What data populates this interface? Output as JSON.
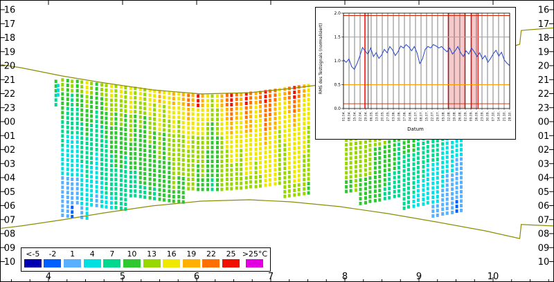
{
  "chart_data": [
    {
      "type": "heatmap",
      "title": "",
      "description": "Night-time temperature thermograph: hour of day (y) vs month (x); colored dashes are temperature samples between the sunset and sunrise envelope curves",
      "x_axis": {
        "label": "",
        "ticks": [
          4,
          5,
          6,
          7,
          8,
          9,
          10
        ],
        "range_months": [
          3.36,
          10.82
        ]
      },
      "y_axis": {
        "label": "",
        "ticks": [
          "16",
          "17",
          "18",
          "19",
          "20",
          "21",
          "22",
          "23",
          "00",
          "01",
          "02",
          "03",
          "04",
          "05",
          "06",
          "07",
          "08",
          "09",
          "10"
        ]
      },
      "legend": {
        "labels": [
          "<-5",
          "-2",
          "1",
          "4",
          "7",
          "10",
          "13",
          "16",
          "19",
          "22",
          "25",
          ">25°C"
        ],
        "colors": [
          "#0000b0",
          "#0060ff",
          "#58b0ff",
          "#00e0e0",
          "#00d890",
          "#30c830",
          "#98d800",
          "#f0e800",
          "#ffb000",
          "#ff7000",
          "#f01000",
          "#e000e0"
        ],
        "unit": "°C"
      },
      "code_map": {
        "a": "<-5",
        "b": "-2",
        "c": "1",
        "d": "4",
        "e": "7",
        "f": "10",
        "g": "13",
        "h": "16",
        "i": "19",
        "j": "22",
        "k": "25",
        "l": ">25"
      },
      "envelope_color": "#8c8c00",
      "sunset_envelope": [
        [
          3.36,
          19.93
        ],
        [
          3.63,
          20.15
        ],
        [
          4.19,
          20.74
        ],
        [
          4.75,
          21.23
        ],
        [
          5.4,
          21.73
        ],
        [
          6.06,
          22.02
        ],
        [
          6.71,
          21.93
        ],
        [
          7.27,
          21.63
        ],
        [
          7.93,
          21.19
        ],
        [
          8.58,
          20.64
        ],
        [
          9.23,
          20.0
        ],
        [
          9.89,
          19.26
        ],
        [
          10.36,
          18.47
        ],
        [
          10.38,
          17.48
        ],
        [
          10.82,
          17.3
        ]
      ],
      "sunrise_envelope": [
        [
          3.36,
          31.62
        ],
        [
          3.63,
          31.45
        ],
        [
          4.19,
          31.01
        ],
        [
          4.75,
          30.52
        ],
        [
          5.4,
          30.02
        ],
        [
          6.06,
          29.68
        ],
        [
          6.71,
          29.58
        ],
        [
          7.27,
          29.73
        ],
        [
          7.93,
          30.07
        ],
        [
          8.58,
          30.57
        ],
        [
          9.23,
          31.16
        ],
        [
          9.89,
          31.8
        ],
        [
          10.36,
          32.35
        ],
        [
          10.38,
          31.35
        ],
        [
          10.82,
          31.45
        ]
      ],
      "columns": [
        [
          4.1,
          21.0,
          "fe"
        ],
        [
          4.13,
          21.3,
          "d"
        ],
        [
          4.19,
          20.9,
          "gffeeddccc"
        ],
        [
          4.26,
          20.95,
          "ffeedddccc"
        ],
        [
          4.32,
          21.0,
          "geeedddccb"
        ],
        [
          4.39,
          21.0,
          "ffeedddcc"
        ],
        [
          4.45,
          21.05,
          "gffeeedddc"
        ],
        [
          4.52,
          21.1,
          "hgffeeeddd"
        ],
        [
          4.58,
          21.15,
          "gffeeeddd"
        ],
        [
          4.65,
          21.2,
          "ffeeedddc"
        ],
        [
          4.72,
          21.25,
          "gffeeeedd"
        ],
        [
          4.78,
          21.3,
          "ggffeeeed"
        ],
        [
          4.85,
          21.35,
          "hggffeeed"
        ],
        [
          4.91,
          21.35,
          "ggffffeee"
        ],
        [
          4.98,
          21.4,
          "hggfffeee"
        ],
        [
          5.04,
          21.45,
          "ggfffeeee"
        ],
        [
          5.11,
          21.5,
          "hhggffee"
        ],
        [
          5.17,
          21.5,
          "ggffffee"
        ],
        [
          5.24,
          21.55,
          "hggffffe"
        ],
        [
          5.3,
          21.6,
          "ggfffffe"
        ],
        [
          5.37,
          21.65,
          "hhggffff"
        ],
        [
          5.43,
          21.7,
          "hggffffe"
        ],
        [
          5.5,
          21.75,
          "ihhggfff"
        ],
        [
          5.56,
          21.8,
          "hggfffff"
        ],
        [
          5.63,
          21.85,
          "hhgggfff"
        ],
        [
          5.69,
          21.9,
          "ihhggggf"
        ],
        [
          5.76,
          21.9,
          "hhggggff"
        ],
        [
          5.82,
          21.95,
          "ihhgggff"
        ],
        [
          5.89,
          22.0,
          "jihhggg"
        ],
        [
          5.95,
          22.0,
          "ihhgggg"
        ],
        [
          6.02,
          22.05,
          "khhggff"
        ],
        [
          6.08,
          22.05,
          "ihhgggf"
        ],
        [
          6.15,
          22.05,
          "hhggfff"
        ],
        [
          6.21,
          22.05,
          "ggffffe"
        ],
        [
          6.28,
          22.05,
          "hggffff"
        ],
        [
          6.34,
          22.05,
          "ihhgggg"
        ],
        [
          6.41,
          22.0,
          "jihhggg"
        ],
        [
          6.47,
          22.0,
          "kjihhgg"
        ],
        [
          6.54,
          21.95,
          "jihhhgg"
        ],
        [
          6.6,
          21.95,
          "ihhhggg"
        ],
        [
          6.67,
          21.9,
          "kjihhhg"
        ],
        [
          6.73,
          21.85,
          "jiihhhg"
        ],
        [
          6.8,
          21.85,
          "ihhhhgg"
        ],
        [
          6.86,
          21.8,
          "jihhhhg"
        ],
        [
          6.93,
          21.75,
          "kjjihhh"
        ],
        [
          6.99,
          21.7,
          "jjihhhh"
        ],
        [
          7.06,
          21.65,
          "jiihhhh"
        ],
        [
          7.12,
          21.6,
          "hhhgggg"
        ],
        [
          7.19,
          21.55,
          "ihhhgggg"
        ],
        [
          7.25,
          21.5,
          "jihhhhgg"
        ],
        [
          7.32,
          21.45,
          "kjihhhhg"
        ],
        [
          7.38,
          21.4,
          "jihhhhhg"
        ],
        [
          7.45,
          21.35,
          "ihhhhggg"
        ],
        [
          7.51,
          21.3,
          "hhhggggf"
        ],
        [
          8.02,
          21.2,
          "ihhggggf"
        ],
        [
          8.08,
          21.15,
          "hhhggggf"
        ],
        [
          8.15,
          21.1,
          "ihhhgggg"
        ],
        [
          8.21,
          21.05,
          "hhgggggff"
        ],
        [
          8.28,
          21.0,
          "hhhggggff"
        ],
        [
          8.34,
          20.9,
          "ihhggggff"
        ],
        [
          8.41,
          20.85,
          "hhgggffff"
        ],
        [
          8.47,
          20.8,
          "hggggffff"
        ],
        [
          8.54,
          20.7,
          "hhgggfffe"
        ],
        [
          8.6,
          20.65,
          "gggffffee"
        ],
        [
          8.67,
          20.55,
          "hggffffee"
        ],
        [
          8.73,
          20.5,
          "ggfffeeee"
        ],
        [
          8.8,
          20.4,
          "hggfffeeee"
        ],
        [
          8.86,
          20.3,
          "ggffffeeee"
        ],
        [
          8.93,
          20.25,
          "gggfffeeed"
        ],
        [
          8.99,
          20.15,
          "ggfffeeedd"
        ],
        [
          9.06,
          20.1,
          "hggffeeedd"
        ],
        [
          9.12,
          20.0,
          "ggfffeeddd"
        ],
        [
          9.19,
          19.95,
          "gffeeeedddc"
        ],
        [
          9.25,
          19.9,
          "ggffeeedddc"
        ],
        [
          9.32,
          19.8,
          "gffeeedddcc"
        ],
        [
          9.38,
          19.75,
          "ffeeedddccc"
        ],
        [
          9.45,
          19.7,
          "gffeedddccc"
        ],
        [
          9.51,
          19.6,
          "ffeedddcccb"
        ],
        [
          9.57,
          19.55,
          "gffeeddcccc"
        ]
      ]
    },
    {
      "type": "line",
      "title": "",
      "ylabel": "RMS des Testsignals (normalisiert)",
      "xlabel": "Datum",
      "yticks": [
        0.0,
        0.5,
        1.0,
        1.5,
        2.0
      ],
      "ylim": [
        0,
        2
      ],
      "xticklabels": [
        "01.04.",
        "08.04.",
        "15.04.",
        "22.04.",
        "29.04.",
        "06.05.",
        "13.05.",
        "20.05.",
        "27.05.",
        "03.06.",
        "10.06.",
        "17.06.",
        "24.06.",
        "01.07.",
        "08.07.",
        "15.07.",
        "22.07.",
        "29.07.",
        "05.08.",
        "12.08.",
        "19.08.",
        "26.08.",
        "02.09.",
        "09.09.",
        "16.09.",
        "23.09.",
        "30.09.",
        "07.10.",
        "14.10.",
        "21.10.",
        "28.10."
      ],
      "series_color": "#2244cc",
      "values": [
        1.02,
        0.97,
        1.04,
        0.88,
        0.82,
        0.95,
        1.1,
        1.28,
        1.2,
        1.14,
        1.27,
        1.09,
        1.17,
        1.05,
        1.12,
        1.24,
        1.17,
        1.3,
        1.23,
        1.11,
        1.19,
        1.31,
        1.27,
        1.34,
        1.29,
        1.21,
        1.3,
        1.17,
        0.94,
        1.04,
        1.24,
        1.3,
        1.27,
        1.34,
        1.31,
        1.27,
        1.3,
        1.24,
        1.19,
        1.27,
        1.14,
        1.21,
        1.3,
        1.17,
        1.09,
        1.21,
        1.14,
        1.27,
        1.19,
        1.09,
        1.17,
        1.04,
        1.11,
        0.97,
        1.05,
        1.15,
        1.22,
        1.1,
        1.18,
        1.02,
        0.95,
        0.9
      ],
      "hlines": [
        {
          "y": 1.95,
          "color": "#cc2200"
        },
        {
          "y": 1.5,
          "color": "#ff9900"
        },
        {
          "y": 0.5,
          "color": "#ff9900"
        },
        {
          "y": 0.1,
          "color": "#cc2200"
        }
      ],
      "red_vline_fracs": [
        0.128,
        0.148
      ],
      "bands": [
        {
          "from": 0.63,
          "to": 0.73
        },
        {
          "from": 0.77,
          "to": 0.81
        }
      ],
      "band_color": "#f6caca",
      "band_edge_color": "#dd0000"
    }
  ]
}
